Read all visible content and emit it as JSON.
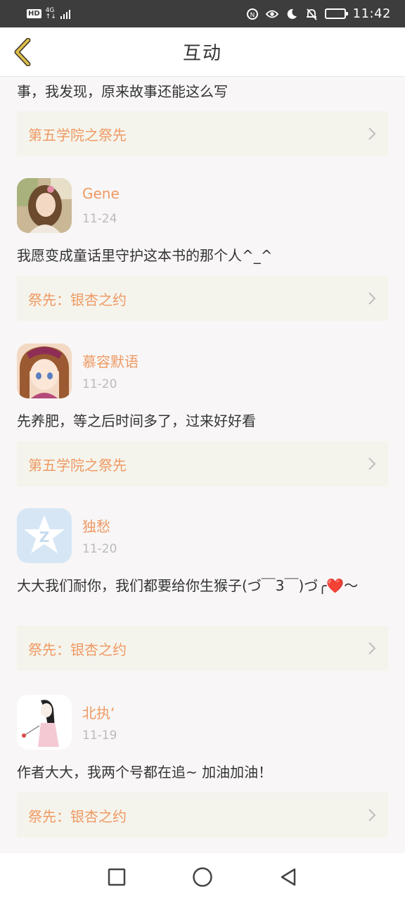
{
  "status_bar": {
    "hd": "HD",
    "net_top": "4G",
    "net_bottom": "↑↓",
    "time": "11:42",
    "icons": [
      "nfc-icon",
      "eye-comfort-icon",
      "moon-icon",
      "bell-off-icon",
      "battery-icon"
    ]
  },
  "header": {
    "title": "互动",
    "back_icon": "chevron-left-icon"
  },
  "partial_comment": {
    "text": "事，我发现，原来故事还能这么写",
    "book": "第五学院之祭先"
  },
  "comments": [
    {
      "user": "Gene",
      "date": "11-24",
      "text": "我愿变成童话里守护这本书的那个人^_^",
      "book": "祭先：银杏之约",
      "avatar": "photo-girl"
    },
    {
      "user": "慕容默语",
      "date": "11-20",
      "text": "先养肥，等之后时间多了，过来好好看",
      "book": "第五学院之祭先",
      "avatar": "anime-girl"
    },
    {
      "user": "独愁",
      "date": "11-20",
      "text": "大大我们耐你，我们都要给你生猴子(づ￣3￣)づ╭❤️～",
      "book": "祭先：银杏之约",
      "avatar": "qq-star"
    },
    {
      "user": "北执ʻ",
      "date": "11-19",
      "text": "作者大大，我两个号都在追~ 加油加油！",
      "book": "祭先：银杏之约",
      "avatar": "sketch-girl"
    }
  ],
  "nav_bar": {
    "icons": [
      "square-icon",
      "circle-icon",
      "triangle-back-icon"
    ]
  },
  "colors": {
    "accent": "#ee9a64",
    "status_bar": "#3d3d3d",
    "link_bg": "#f5f4ec",
    "date": "#bbbbbb",
    "back_icon": "#d8b84a"
  }
}
